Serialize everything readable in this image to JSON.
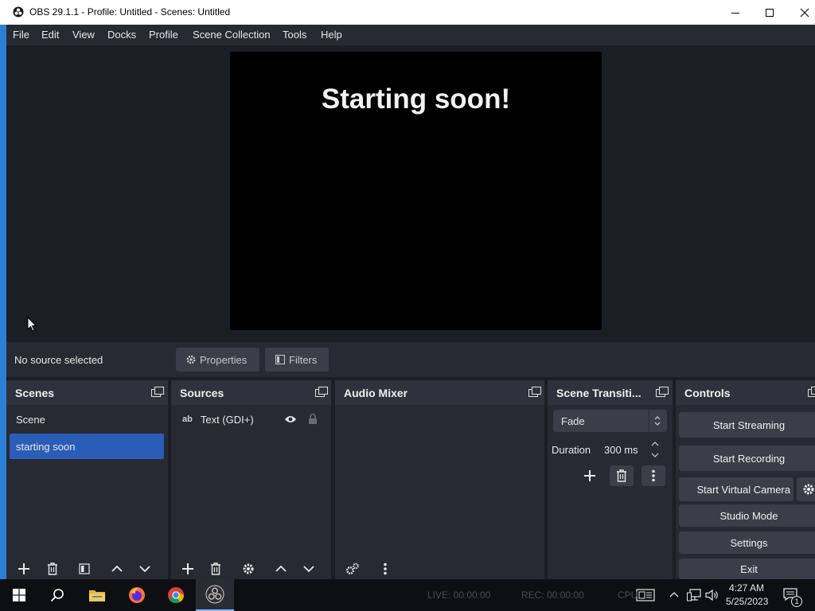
{
  "window": {
    "title": "OBS 29.1.1 - Profile: Untitled - Scenes: Untitled"
  },
  "menu": [
    "File",
    "Edit",
    "View",
    "Docks",
    "Profile",
    "Scene Collection",
    "Tools",
    "Help"
  ],
  "preview": {
    "text": "Starting soon!"
  },
  "source_toolbar": {
    "status": "No source selected",
    "properties_label": "Properties",
    "filters_label": "Filters"
  },
  "docks": {
    "scenes": {
      "title": "Scenes",
      "items": [
        "Scene",
        "starting soon"
      ],
      "selected_index": 1
    },
    "sources": {
      "title": "Sources",
      "items": [
        {
          "type_icon": "text-ab-icon",
          "label": "Text (GDI+)"
        }
      ]
    },
    "audio_mixer": {
      "title": "Audio Mixer"
    },
    "transitions": {
      "title": "Scene Transiti...",
      "transition": "Fade",
      "duration_label": "Duration",
      "duration_value": "300 ms"
    },
    "controls": {
      "title": "Controls",
      "start_streaming": "Start Streaming",
      "start_recording": "Start Recording",
      "start_virtual_camera": "Start Virtual Camera",
      "studio_mode": "Studio Mode",
      "settings": "Settings",
      "exit": "Exit"
    }
  },
  "statusbar": {
    "live": "LIVE: 00:00:00",
    "rec": "REC: 00:00:00",
    "cpu": "CPU"
  },
  "taskbar": {
    "time": "4:27 AM",
    "date": "5/25/2023",
    "notification_count": "1"
  },
  "colors": {
    "accent": "#2a5db7",
    "dock_bg": "#272a33",
    "window_bg": "#1c1e26"
  }
}
